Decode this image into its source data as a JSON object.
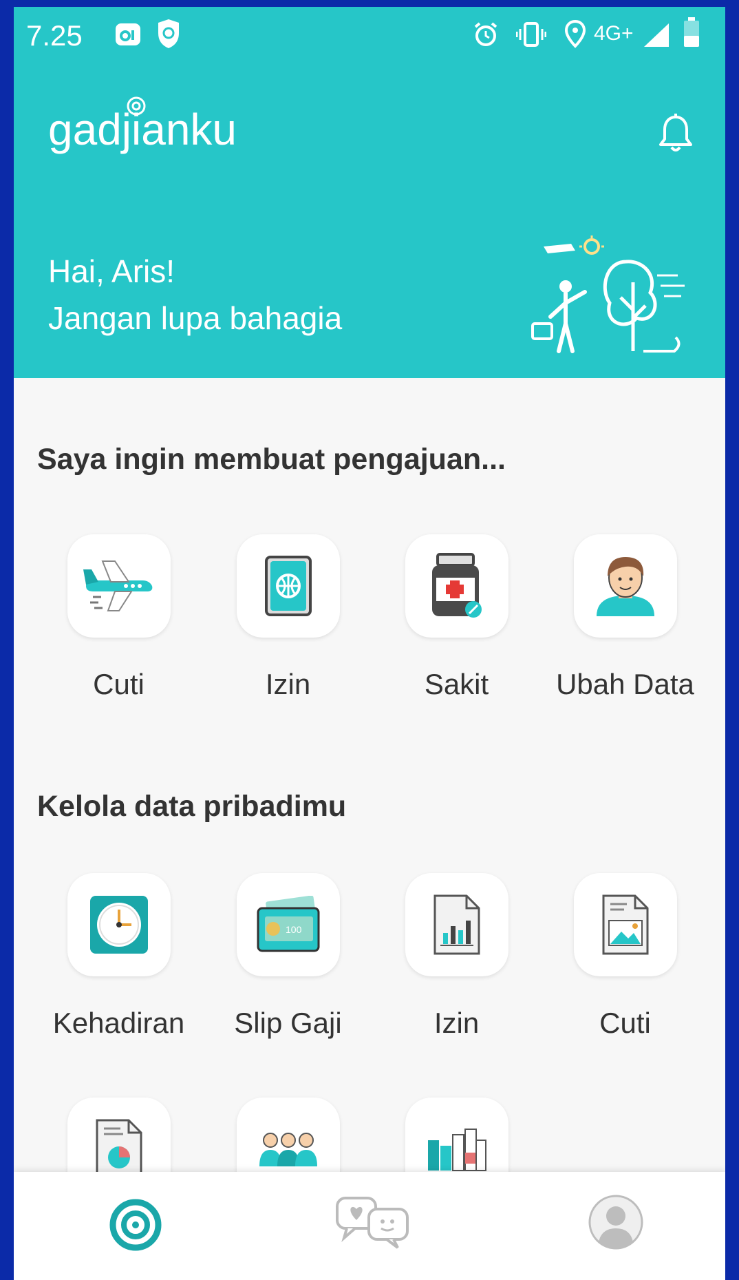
{
  "status_bar": {
    "time": "7.25",
    "network": "4G+"
  },
  "header": {
    "logo_text": "gadjianku",
    "greeting_line1": "Hai, Aris!",
    "greeting_line2": "Jangan lupa bahagia"
  },
  "section_request": {
    "title": "Saya ingin membuat pengajuan...",
    "items": [
      {
        "label": "Cuti",
        "icon": "airplane-icon"
      },
      {
        "label": "Izin",
        "icon": "passport-icon"
      },
      {
        "label": "Sakit",
        "icon": "medicine-bottle-icon"
      },
      {
        "label": "Ubah Data",
        "icon": "user-avatar-icon"
      }
    ]
  },
  "section_data": {
    "title": "Kelola data pribadimu",
    "items": [
      {
        "label": "Kehadiran",
        "icon": "clock-icon"
      },
      {
        "label": "Slip Gaji",
        "icon": "wallet-icon"
      },
      {
        "label": "Izin",
        "icon": "bar-chart-document-icon"
      },
      {
        "label": "Cuti",
        "icon": "image-document-icon"
      },
      {
        "label": "",
        "icon": "pie-chart-document-icon"
      },
      {
        "label": "",
        "icon": "team-icon"
      },
      {
        "label": "",
        "icon": "calendar-grid-icon"
      }
    ]
  },
  "bottom_nav": {
    "items": [
      {
        "name": "home",
        "icon": "swirl-logo-icon",
        "active": true
      },
      {
        "name": "chat",
        "icon": "chat-bubbles-icon",
        "active": false
      },
      {
        "name": "profile",
        "icon": "profile-icon",
        "active": false
      }
    ]
  },
  "colors": {
    "primary": "#26c6c8",
    "accent_dark": "#1aa7a9",
    "text": "#333333",
    "border": "#0b2aa8"
  }
}
